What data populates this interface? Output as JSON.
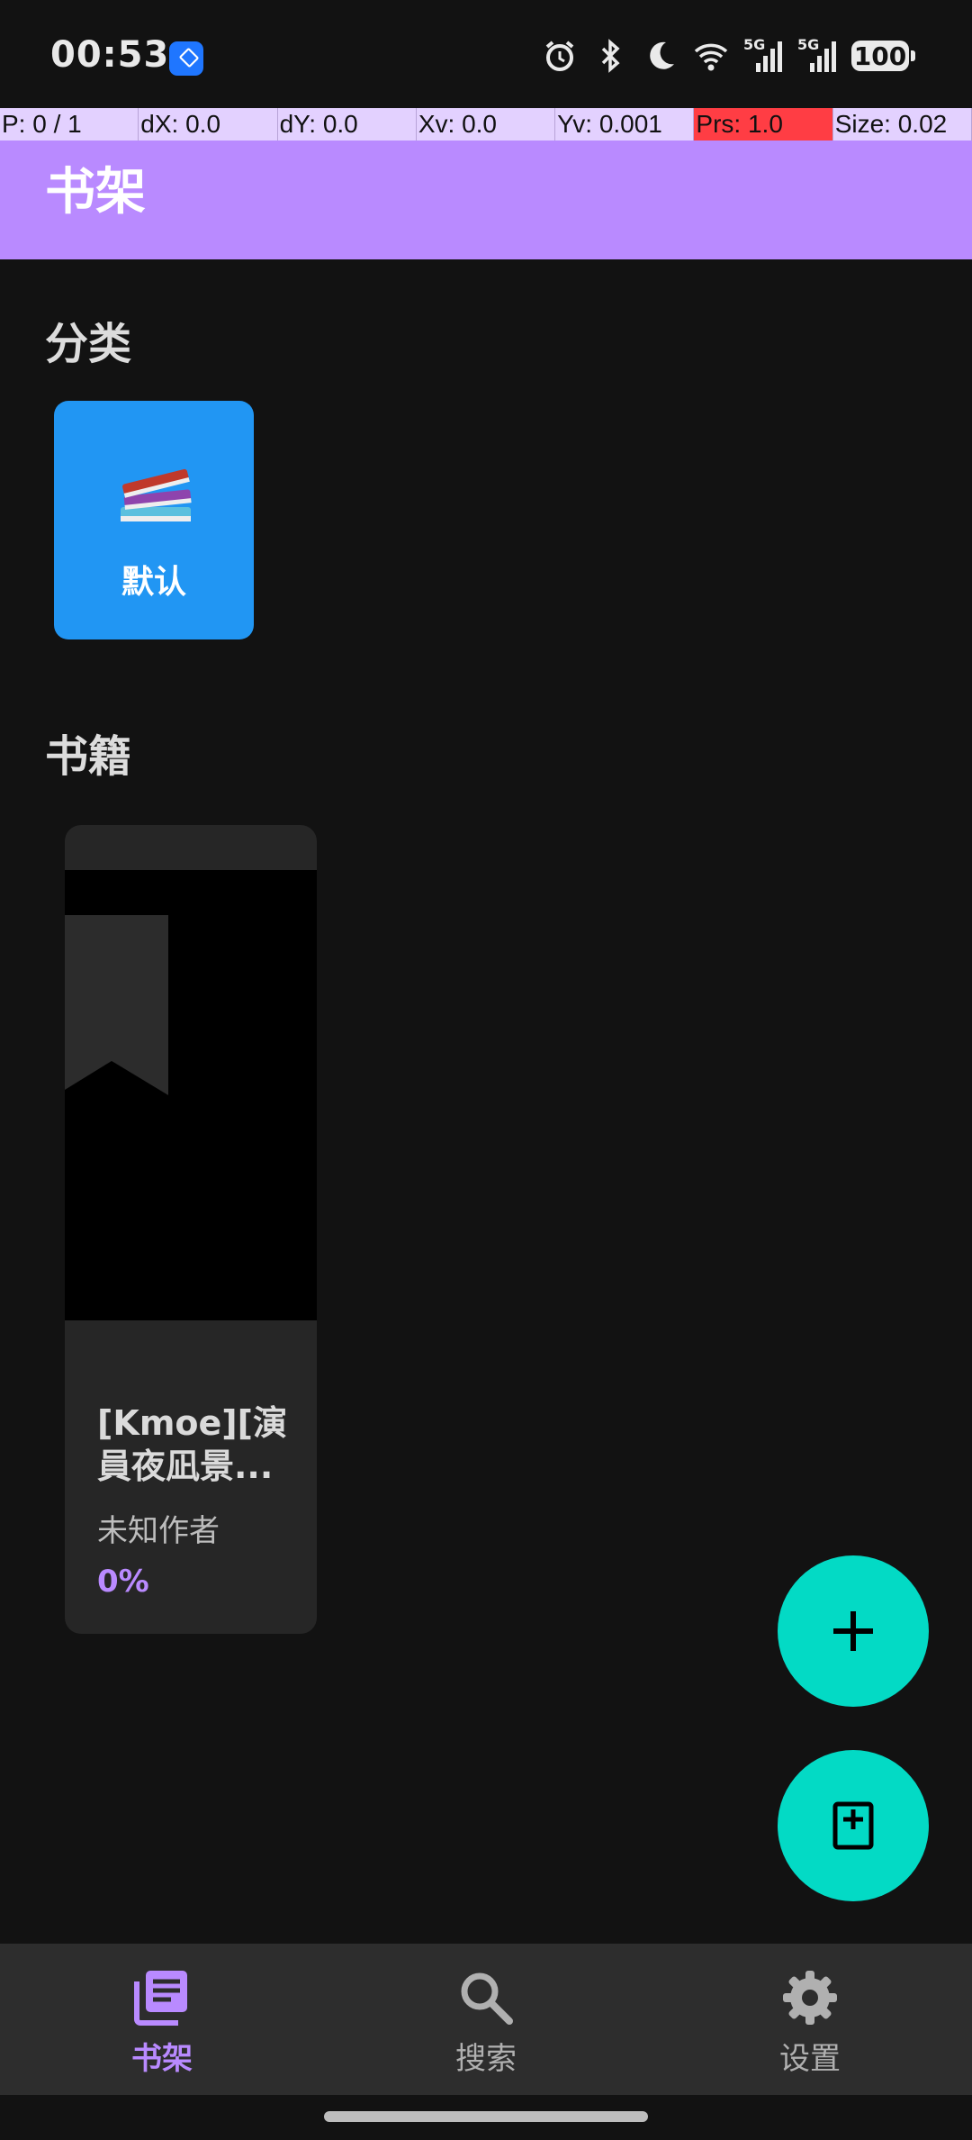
{
  "status_bar": {
    "time": "00:53",
    "icons": [
      "app-notification-icon",
      "alarm-icon",
      "bluetooth-icon",
      "do-not-disturb-moon-icon",
      "wifi-icon",
      "signal-5g-icon",
      "signal-5g-icon"
    ],
    "signal_label_1": "5G",
    "signal_label_2": "5G",
    "battery": "100"
  },
  "debug_overlay": {
    "p": "P: 0 / 1",
    "dx": "dX: 0.0",
    "dy": "dY: 0.0",
    "xv": "Xv: 0.0",
    "yv": "Yv: 0.001",
    "prs": "Prs: 1.0",
    "size": "Size: 0.02"
  },
  "app_bar": {
    "title": "书架"
  },
  "categories": {
    "heading": "分类",
    "items": [
      {
        "label": "默认",
        "icon": "books-icon",
        "color": "#2196f3"
      }
    ]
  },
  "books": {
    "heading": "书籍",
    "items": [
      {
        "title": "[Kmoe][演員夜凪景...",
        "author": "未知作者",
        "progress": "0%"
      }
    ]
  },
  "fabs": [
    {
      "icon": "plus-icon",
      "color": "#03dac5"
    },
    {
      "icon": "add-book-icon",
      "color": "#03dac5"
    }
  ],
  "bottom_nav": {
    "items": [
      {
        "label": "书架",
        "icon": "bookshelf-icon",
        "active": true
      },
      {
        "label": "搜索",
        "icon": "search-icon",
        "active": false
      },
      {
        "label": "设置",
        "icon": "settings-gear-icon",
        "active": false
      }
    ]
  },
  "colors": {
    "accent": "#b98aff",
    "background": "#121212",
    "fab": "#03dac5",
    "category_tile": "#2196f3"
  }
}
